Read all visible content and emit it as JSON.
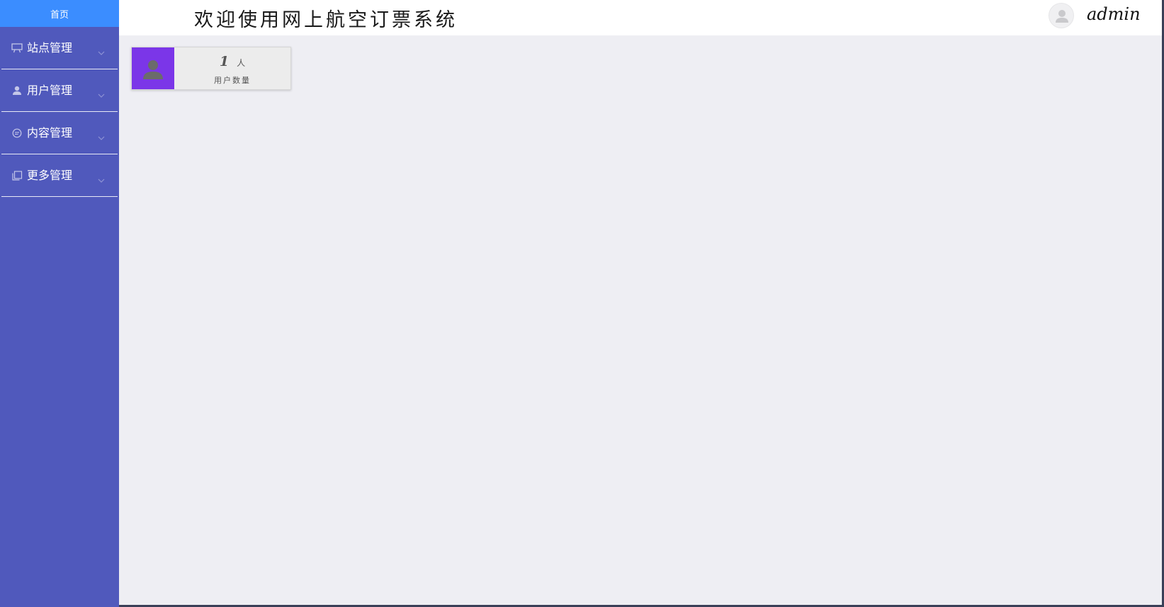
{
  "sidebar": {
    "home_label": "首页",
    "items": [
      {
        "label": "站点管理",
        "icon": "monitor-icon"
      },
      {
        "label": "用户管理",
        "icon": "user-icon"
      },
      {
        "label": "内容管理",
        "icon": "message-icon"
      },
      {
        "label": "更多管理",
        "icon": "copy-icon"
      }
    ]
  },
  "header": {
    "title": "欢迎使用网上航空订票系统",
    "username": "admin"
  },
  "dashboard": {
    "user_stat": {
      "count": "1",
      "unit": "人",
      "label": "用户数量",
      "icon": "user-icon",
      "accent_color": "#7b36e8"
    }
  },
  "colors": {
    "sidebar_bg": "#5059bc",
    "home_bar": "#3b8dff",
    "main_bg": "#eeeef3"
  }
}
